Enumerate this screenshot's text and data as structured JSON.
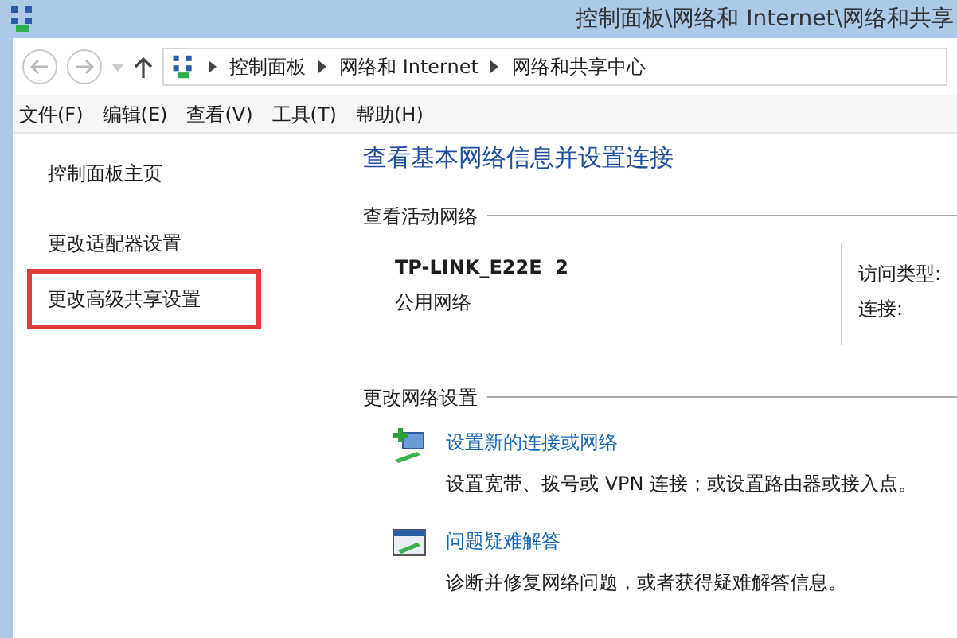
{
  "window": {
    "title": "控制面板\\网络和 Internet\\网络和共享"
  },
  "address_bar": {
    "breadcrumbs": [
      "控制面板",
      "网络和 Internet",
      "网络和共享中心"
    ]
  },
  "menu": [
    "文件(F)",
    "编辑(E)",
    "查看(V)",
    "工具(T)",
    "帮助(H)"
  ],
  "sidebar": {
    "items": [
      {
        "label": "控制面板主页",
        "highlighted": false
      },
      {
        "label": "更改适配器设置",
        "highlighted": false
      },
      {
        "label": "更改高级共享设置",
        "highlighted": true
      }
    ]
  },
  "main": {
    "heading": "查看基本网络信息并设置连接",
    "active_networks": {
      "title": "查看活动网络",
      "network_name": "TP-LINK_E22E  2",
      "network_type": "公用网络",
      "labels": [
        "访问类型:",
        "连接:"
      ]
    },
    "change_settings": {
      "title": "更改网络设置",
      "tasks": [
        {
          "kind": "new-connection",
          "link": "设置新的连接或网络",
          "description": "设置宽带、拨号或 VPN 连接；或设置路由器或接入点。"
        },
        {
          "kind": "troubleshoot",
          "link": "问题疑难解答",
          "description": "诊断并修复网络问题，或者获得疑难解答信息。"
        }
      ]
    }
  }
}
